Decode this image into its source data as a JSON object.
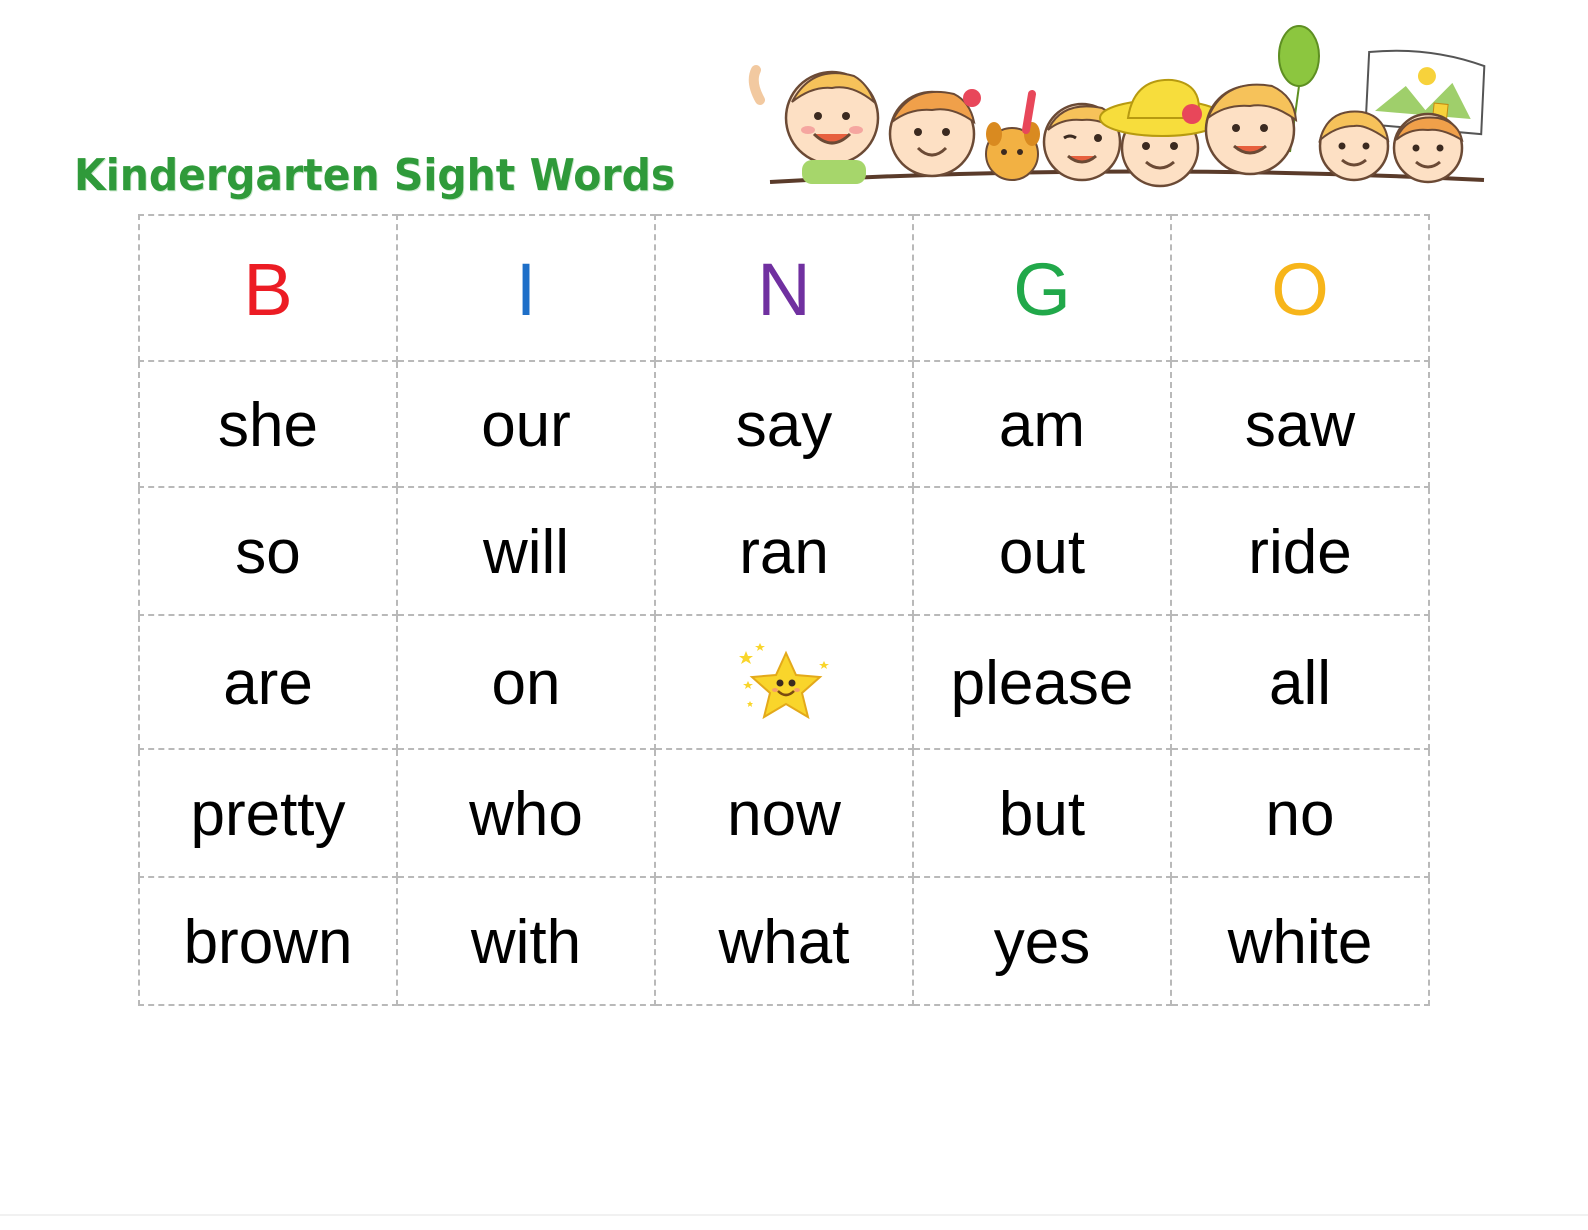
{
  "title": "Kindergarten Sight Words",
  "bingo": {
    "header": [
      {
        "letter": "B",
        "color": "#ec1c24"
      },
      {
        "letter": "I",
        "color": "#1e6fc8"
      },
      {
        "letter": "N",
        "color": "#7030a0"
      },
      {
        "letter": "G",
        "color": "#21a84a"
      },
      {
        "letter": "O",
        "color": "#f7b51a"
      }
    ],
    "rows": [
      [
        "she",
        "our",
        "say",
        "am",
        "saw"
      ],
      [
        "so",
        "will",
        "ran",
        "out",
        "ride"
      ],
      [
        "are",
        "on",
        "",
        "please",
        "all"
      ],
      [
        "pretty",
        "who",
        "now",
        "but",
        "no"
      ],
      [
        "brown",
        "with",
        "what",
        "yes",
        "white"
      ]
    ],
    "free_space_icon": "smiling-star-icon"
  },
  "decoration": {
    "illustration": "children-peeking-illustration"
  }
}
